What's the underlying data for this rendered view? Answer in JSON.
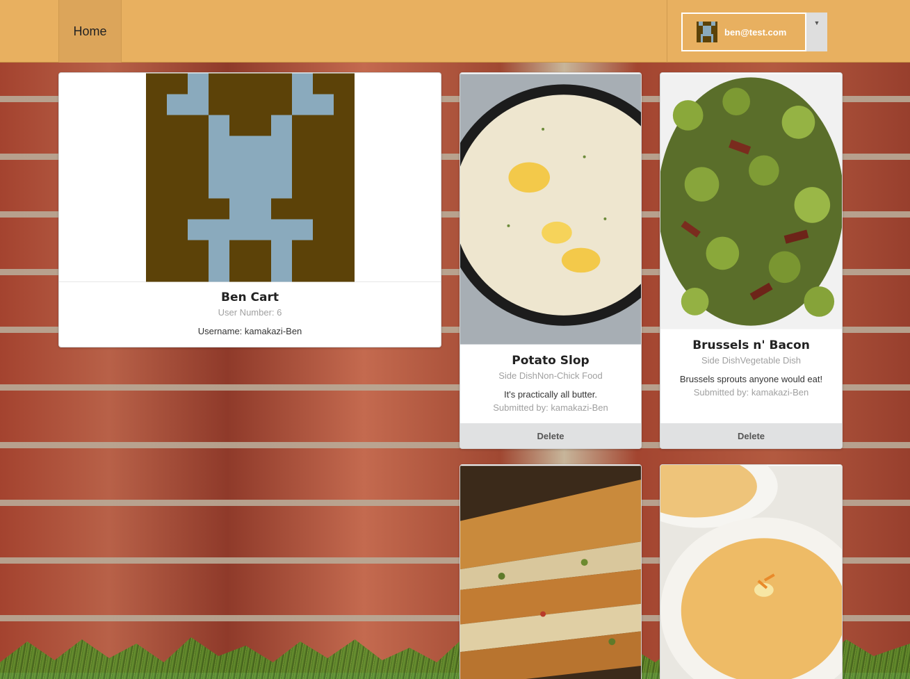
{
  "nav": {
    "home_label": "Home",
    "user_email": "ben@test.com"
  },
  "profile": {
    "name": "Ben Cart",
    "user_number": "User Number: 6",
    "username": "Username: kamakazi-Ben"
  },
  "recipes": [
    {
      "title": "Potato Slop",
      "categories": "Side DishNon-Chick Food",
      "description": "It's practically all butter.",
      "submitted_by": "Submitted by: kamakazi-Ben",
      "delete_label": "Delete",
      "image_alt": "mashed potatoes with butter"
    },
    {
      "title": "Brussels n' Bacon",
      "categories": "Side DishVegetable Dish",
      "description": "Brussels sprouts anyone would eat!",
      "submitted_by": "Submitted by: kamakazi-Ben",
      "delete_label": "Delete",
      "image_alt": "roasted brussels sprouts with bacon"
    },
    {
      "image_alt": "stacked quesadillas"
    },
    {
      "image_alt": "cheese soup in bowl"
    }
  ],
  "colors": {
    "navbar": "#e8b060",
    "avatar_bg": "#5c4208",
    "avatar_fg": "#8aaabd"
  }
}
